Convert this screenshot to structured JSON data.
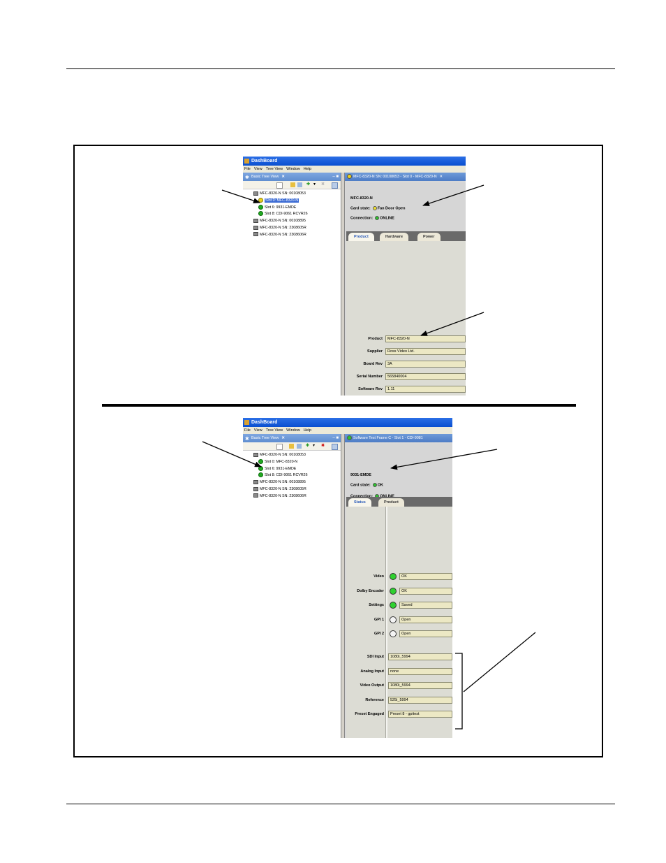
{
  "top_screenshot": {
    "window_title": "DashBoard",
    "menu": [
      "File",
      "View",
      "Tree View",
      "Window",
      "Help"
    ],
    "view_tab": "Basic Tree View",
    "tree": [
      {
        "label": "MFC-8320-N SN: 00108053",
        "kind": "chassis",
        "indent": 0
      },
      {
        "label": "Slot 0: MFC-8320-N",
        "kind": "yellow",
        "indent": 1,
        "selected": true
      },
      {
        "label": "Slot 6: 9931-EMDE",
        "kind": "green",
        "indent": 1
      },
      {
        "label": "Slot 8: CDI-9061 RCVR26",
        "kind": "green",
        "indent": 1
      },
      {
        "label": "MFC-8320-N SN: 00108895",
        "kind": "chassis",
        "indent": 0
      },
      {
        "label": "MFC-8320-N SN: 2308605R",
        "kind": "chassis",
        "indent": 0
      },
      {
        "label": "MFC-8320-N SN: 2308606R",
        "kind": "chassis",
        "indent": 0
      }
    ],
    "editor_tab": "MFC-8320-N SN: 00108053 - Slot 0 - MFC-8320-N",
    "card_name": "MFC-8320-N",
    "card_state_label": "Card state:",
    "card_state_value": "Fan Door Open",
    "connection_label": "Connection:",
    "connection_value": "ONLINE",
    "tabs": [
      "Product",
      "Hardware",
      "Power"
    ],
    "fields": [
      {
        "label": "Product",
        "value": "MFC-8320-N"
      },
      {
        "label": "Supplier",
        "value": "Ross Video Ltd."
      },
      {
        "label": "Board Rev",
        "value": "3A"
      },
      {
        "label": "Serial Number",
        "value": "565840004"
      },
      {
        "label": "Software Rev",
        "value": "1.11"
      }
    ]
  },
  "bottom_screenshot": {
    "window_title": "DashBoard",
    "menu": [
      "File",
      "View",
      "Tree View",
      "Window",
      "Help"
    ],
    "view_tab": "Basic Tree View",
    "tree": [
      {
        "label": "MFC-8320-N SN: 00108053",
        "kind": "chassis",
        "indent": 0
      },
      {
        "label": "Slot 0: MFC-8320-N",
        "kind": "green",
        "indent": 1
      },
      {
        "label": "Slot 6: 9931-EMDE",
        "kind": "green",
        "indent": 1
      },
      {
        "label": "Slot 8: CDI-9061 RCVR26",
        "kind": "green",
        "indent": 1
      },
      {
        "label": "MFC-8320-N SN: 00108895",
        "kind": "chassis",
        "indent": 0
      },
      {
        "label": "MFC-8320-N SN: 2308605R",
        "kind": "chassis",
        "indent": 0
      },
      {
        "label": "MFC-8320-N SN: 2308606R",
        "kind": "chassis",
        "indent": 0
      }
    ],
    "editor_tab": "Software Test Frame C - Slot 1 - CDI-9081",
    "card_name": "9031-EMDE",
    "card_state_label": "Card state:",
    "card_state_value": "OK",
    "connection_label": "Connection:",
    "connection_value": "ONLINE",
    "tabs": [
      "Status",
      "Product"
    ],
    "status_fields": [
      {
        "label": "Video",
        "value": "OK",
        "led": "on"
      },
      {
        "label": "Dolby Encoder",
        "value": "OK",
        "led": "on"
      },
      {
        "label": "Settings",
        "value": "Saved",
        "led": "on"
      },
      {
        "label": "GPI 1",
        "value": "Open",
        "led": "off"
      },
      {
        "label": "GPI 2",
        "value": "Open",
        "led": "off"
      }
    ],
    "signal_fields": [
      {
        "label": "SDI Input",
        "value": "1080i_5994"
      },
      {
        "label": "Analog Input",
        "value": "none"
      },
      {
        "label": "Video Output",
        "value": "1080i_5994"
      },
      {
        "label": "Reference",
        "value": "525i_5994"
      },
      {
        "label": "Preset Engaged",
        "value": "Preset 8 - gpitest"
      }
    ]
  }
}
